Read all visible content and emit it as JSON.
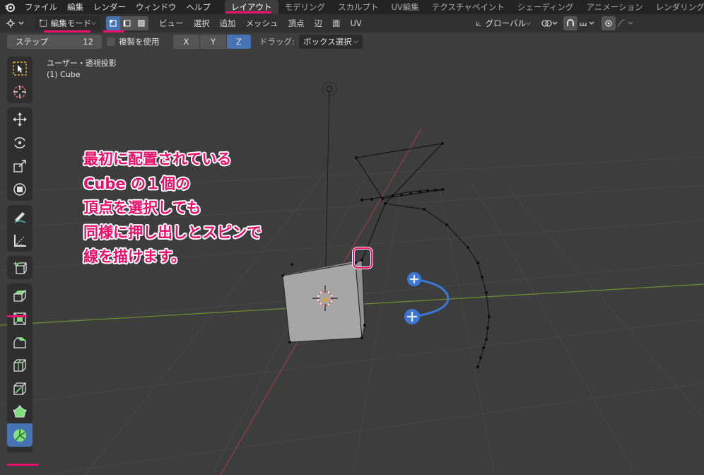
{
  "menu": [
    "ファイル",
    "編集",
    "レンダー",
    "ウィンドウ",
    "ヘルプ"
  ],
  "workspaces": [
    "レイアウト",
    "モデリング",
    "スカルプト",
    "UV編集",
    "テクスチャペイント",
    "シェーディング",
    "アニメーション",
    "レンダリング"
  ],
  "header": {
    "mode": "編集モード",
    "menus": [
      "ビュー",
      "選択",
      "追加",
      "メッシュ",
      "頂点",
      "辺",
      "面",
      "UV"
    ],
    "transform_orientation": "グローバル"
  },
  "toolset": {
    "step_label": "ステップ",
    "step_value": "12",
    "duplicate_label": "複製を使用",
    "axes": [
      "X",
      "Y",
      "Z"
    ],
    "active_axis": "Z",
    "drag_label": "ドラッグ:",
    "drag_value": "ボックス選択"
  },
  "viewport": {
    "view_label": "ユーザー・透視投影",
    "object_label": "(1) Cube"
  },
  "annotation": {
    "lines": [
      "最初に配置されている",
      "Cube の１個の",
      "頂点を選択しても",
      "同様に押し出しとスピンで",
      "線を描けます。"
    ]
  },
  "tools": [
    "select-box",
    "cursor",
    "move",
    "rotate",
    "scale",
    "transform",
    "annotate",
    "measure",
    "add-cube",
    "extrude-region",
    "inset-faces",
    "bevel",
    "loop-cut",
    "knife",
    "poly-build",
    "spin"
  ],
  "colors": {
    "accent": "#4772b3",
    "annotation": "#e8106a",
    "x_axis": "#8f3d45",
    "y_axis": "#6c8a2e"
  }
}
